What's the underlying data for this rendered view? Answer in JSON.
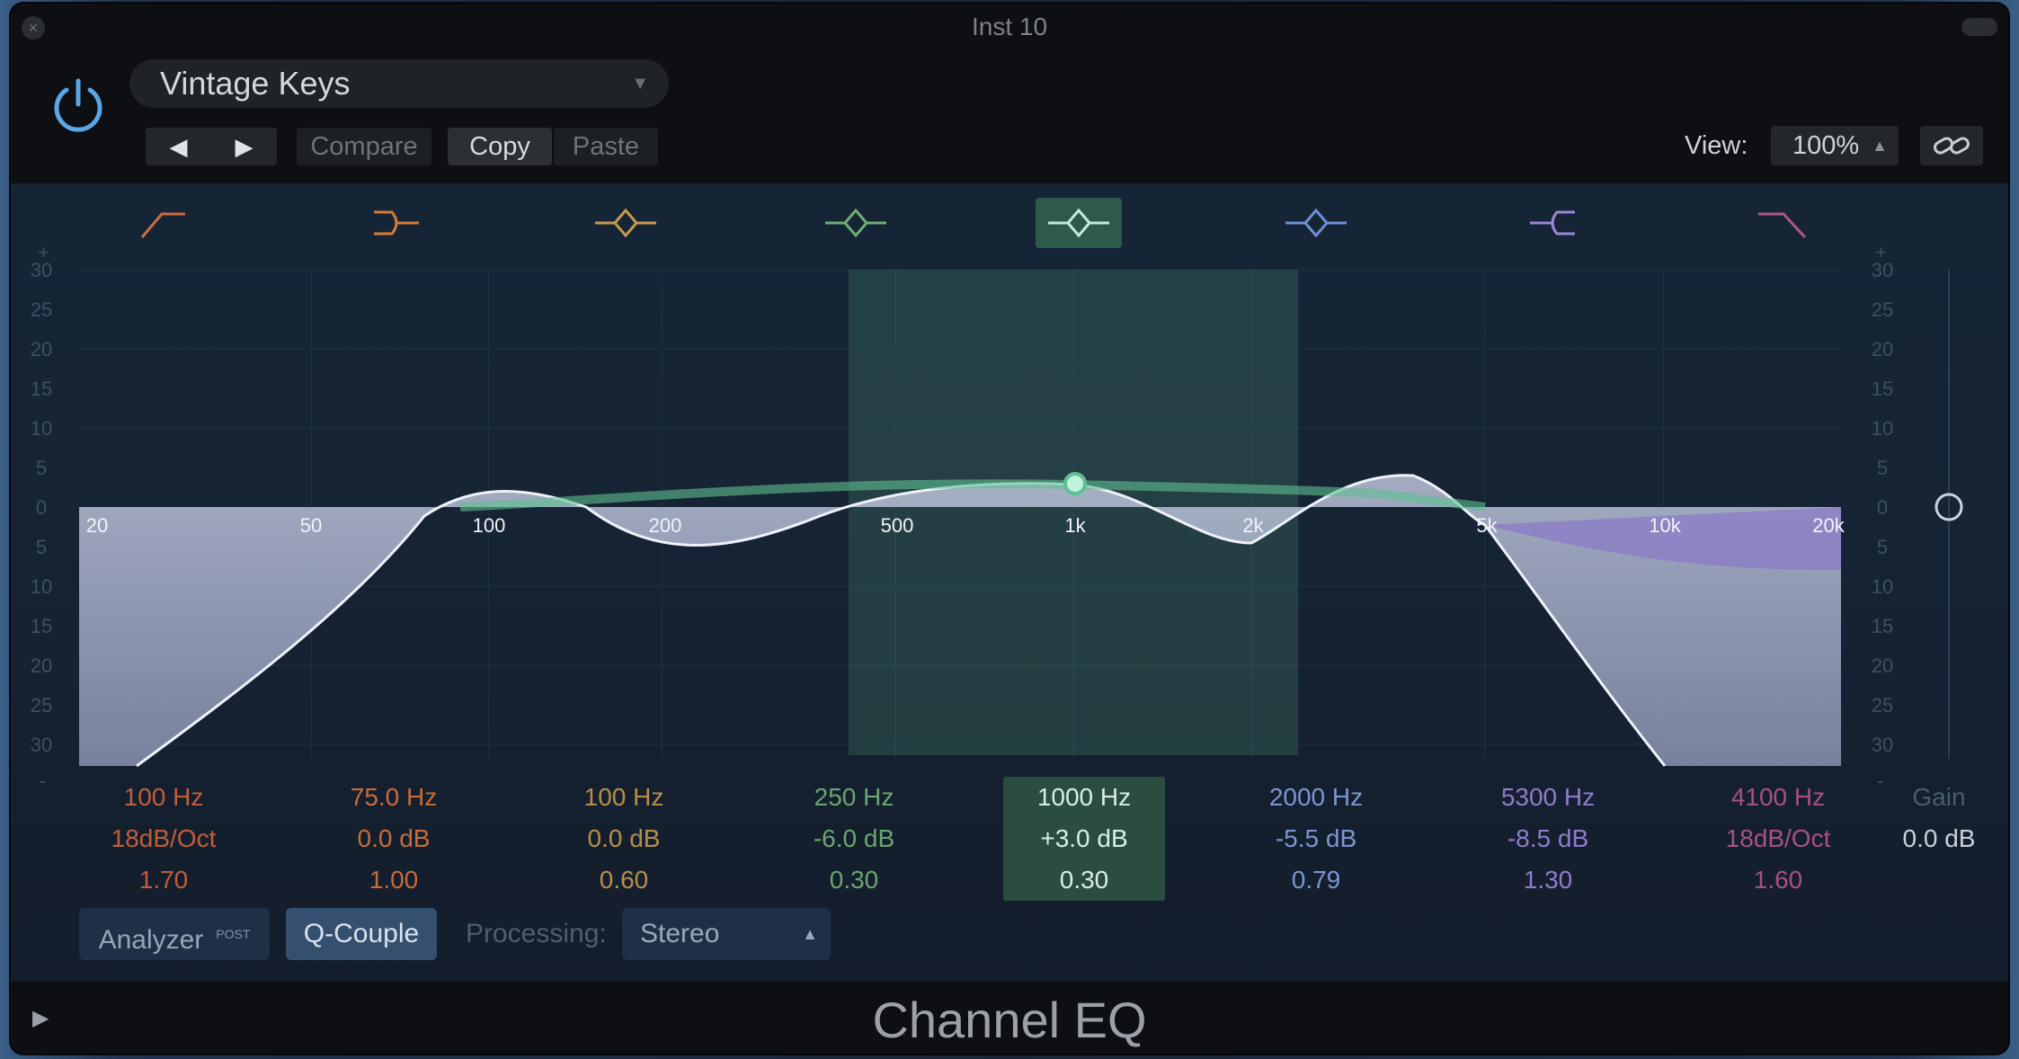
{
  "window": {
    "title": "Inst 10"
  },
  "header": {
    "preset": "Vintage Keys",
    "nav_prev": "◀",
    "nav_next": "▶",
    "compare": "Compare",
    "copy": "Copy",
    "paste": "Paste",
    "view_label": "View:",
    "view_value": "100%"
  },
  "eq": {
    "db_scale": [
      "30",
      "25",
      "20",
      "15",
      "10",
      "5",
      "0",
      "5",
      "10",
      "15",
      "20",
      "25",
      "30"
    ],
    "freq_labels": [
      "20",
      "50",
      "100",
      "200",
      "500",
      "1k",
      "2k",
      "5k",
      "10k",
      "20k"
    ],
    "bands": [
      {
        "name": "low-cut",
        "color": "#d16a40",
        "freq": "100 Hz",
        "gain": "18dB/Oct",
        "q": "1.70"
      },
      {
        "name": "low-shelf",
        "color": "#d47a3a",
        "freq": "75.0 Hz",
        "gain": "0.0 dB",
        "q": "1.00"
      },
      {
        "name": "bell-1",
        "color": "#c89a50",
        "freq": "100 Hz",
        "gain": "0.0 dB",
        "q": "0.60"
      },
      {
        "name": "bell-2",
        "color": "#6fae74",
        "freq": "250 Hz",
        "gain": "-6.0 dB",
        "q": "0.30"
      },
      {
        "name": "bell-3",
        "color": "#7ed1ad",
        "freq": "1000 Hz",
        "gain": "+3.0 dB",
        "q": "0.30",
        "active": true
      },
      {
        "name": "bell-4",
        "color": "#6f8fd6",
        "freq": "2000 Hz",
        "gain": "-5.5 dB",
        "q": "0.79"
      },
      {
        "name": "high-shelf",
        "color": "#9a86d6",
        "freq": "5300 Hz",
        "gain": "-8.5 dB",
        "q": "1.30"
      },
      {
        "name": "high-cut",
        "color": "#b0558f",
        "freq": "4100 Hz",
        "gain": "18dB/Oct",
        "q": "1.60"
      }
    ],
    "gain_label": "Gain",
    "gain_value": "0.0 dB"
  },
  "controls": {
    "analyzer": "Analyzer",
    "analyzer_post": "POST",
    "q_couple": "Q-Couple",
    "processing_label": "Processing:",
    "processing_value": "Stereo"
  },
  "footer": {
    "plugin_name": "Channel EQ"
  }
}
